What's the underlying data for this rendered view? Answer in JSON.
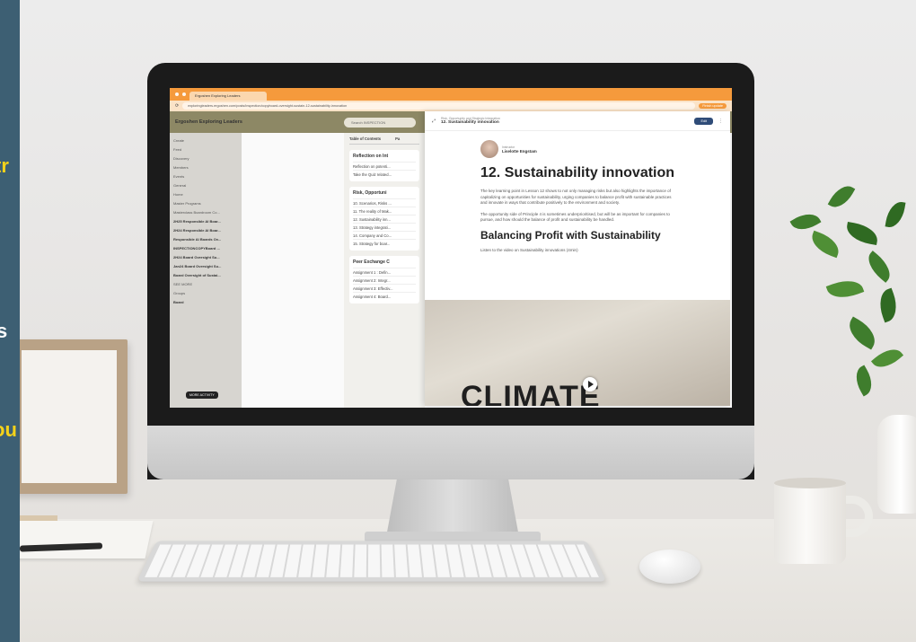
{
  "left_strip_text": {
    "line1": "tr",
    "line2": "s",
    "line3": "ou"
  },
  "browser": {
    "tab_title": "Ergoshen Exploring Leaders",
    "url": "exploringleaders.ergoshen.com/posts/inspection/copyboard-oversight-sustain-12-sustainability-innovation",
    "finish_button": "Finish update"
  },
  "app": {
    "brand": "Ergoshen Exploring Leaders",
    "search_placeholder": "Search INSPECTION",
    "sidebar": {
      "items": [
        "Create",
        "Feed",
        "Discovery",
        "Members",
        "Events",
        "General",
        "Home",
        "Master Programs",
        "Masterclass Boardroom Co...",
        "2H25 Responsible AI Boar...",
        "2H24 Responsible AI Boar...",
        "Responsible AI Boards Ov...",
        "INSPECTIONCOPYBoard ...",
        "2H24 Board Oversight Su...",
        "Jan24 Board Oversight Su...",
        "Board Oversight of Sustai...",
        "SEE MORE",
        "Groups",
        "Board"
      ],
      "more_activity": "MORE ACTIVITY"
    },
    "toc": {
      "tab_contents": "Table of Contents",
      "tab_second": "Pa",
      "sections": [
        {
          "title": "Reflection on Int",
          "items": [
            "Reflection on potenti...",
            "Take the Quiz related..."
          ]
        },
        {
          "title": "Risk, Opportuni",
          "items": [
            "10. Scenarios, Risks ...",
            "11. The reality of Mak...",
            "12. Sustainability inn...",
            "13. Strategy integrati...",
            "14. Company and Co...",
            "15. Strategy for boar..."
          ]
        },
        {
          "title": "Peer Exchange C",
          "items": [
            "Assignment 1 : Defin...",
            "Assignment 2: Integr...",
            "Assignment 3: Effectiv...",
            "Assignment 4: Board..."
          ]
        }
      ]
    },
    "lesson": {
      "course": "Risk, Opportunity and Strategic Integration",
      "title_small": "12. Sustainability innovation",
      "edit": "Edit",
      "instructor_label": "Instructor",
      "instructor_name": "Liselotte Engstam",
      "heading": "12. Sustainability innovation",
      "para1": "The key learning point in Lesson 12 shows to not only managing risks but also highlights the importance of capitalizing on opportunities for sustainability, urging companies to balance profit with sustainable practices and innovate in ways that contribute positively to the environment and society.",
      "para2": "The opportunity side of Principle 4 is sometimes underprioritised, but will be as important for companies to pursue, and how should the balance of profit and sustainability be handled.",
      "subheading": "Balancing Profit with Sustainability",
      "listen": "Listen to the video on Sustainability innovations (4min)",
      "video_word": "CLIMATE"
    }
  },
  "colors": {
    "accent": "#f59a3c",
    "strip": "#3d5f73",
    "brand_bar": "#8d8865"
  }
}
